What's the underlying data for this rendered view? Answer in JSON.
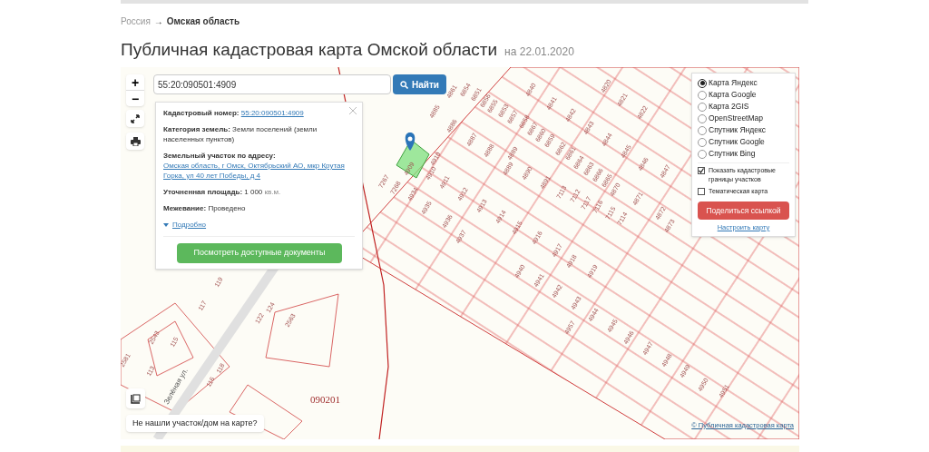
{
  "breadcrumb": {
    "items": [
      {
        "text": "Россия",
        "current": false
      },
      {
        "text": "Омская область",
        "current": true
      }
    ],
    "separator": "→"
  },
  "title": {
    "text": "Публичная кадастровая карта Омской области",
    "date": "на 22.01.2020"
  },
  "search": {
    "value": "55:20:090501:4909",
    "button": "Найти"
  },
  "map_controls": {
    "zoom_in": "+",
    "zoom_out": "−"
  },
  "info_popup": {
    "fields": [
      {
        "label": "Кадастровый номер:",
        "value": "55:20:090501:4909",
        "kind": "link"
      },
      {
        "label": "Категория земель:",
        "value": "Земли поселений (земли населенных пунктов)",
        "kind": "text"
      },
      {
        "label": "Земельный участок по адресу:",
        "value": "Омская область, г Омск, Октябрьский АО, мкр Крутая Горка, ул 40 лет Победы, д 4",
        "kind": "link"
      },
      {
        "label": "Уточненная площадь:",
        "value": "1 000",
        "unit": "кв.м.",
        "kind": "text"
      },
      {
        "label": "Межевание:",
        "value": "Проведено",
        "kind": "text"
      }
    ],
    "more_link": "Подробно",
    "button": "Посмотреть доступные документы"
  },
  "layers": {
    "base_maps": [
      {
        "label": "Карта Яндекс",
        "selected": true
      },
      {
        "label": "Карта Google",
        "selected": false
      },
      {
        "label": "Карта 2GIS",
        "selected": false
      },
      {
        "label": "OpenStreetMap",
        "selected": false
      },
      {
        "label": "Спутник Яндекс",
        "selected": false
      },
      {
        "label": "Спутник Google",
        "selected": false
      },
      {
        "label": "Спутник Bing",
        "selected": false
      }
    ],
    "overlays": [
      {
        "label": "Показать кадастровые границы участков",
        "checked": true
      },
      {
        "label": "Тематическая карта",
        "checked": false
      }
    ],
    "share_button": "Поделиться ссылкой",
    "settings_link": "Настроить карту"
  },
  "map": {
    "labels": [
      "4861",
      "6854",
      "6851",
      "6856",
      "6855",
      "6853",
      "6857",
      "6858",
      "6867",
      "6860",
      "6859",
      "6862",
      "6861",
      "6864",
      "6863",
      "6866",
      "6865",
      "4885",
      "4886",
      "4887",
      "4888",
      "4889",
      "4889",
      "4890",
      "4891",
      "7113",
      "7112",
      "7117",
      "7116",
      "7115",
      "7114",
      "4870",
      "4871",
      "4872",
      "4873",
      "4840",
      "4841",
      "4842",
      "4843",
      "4844",
      "4845",
      "4846",
      "4847",
      "4820",
      "4821",
      "4822",
      "4910",
      "4910",
      "4909",
      "4911",
      "4912",
      "4913",
      "4914",
      "4915",
      "4916",
      "4934",
      "4935",
      "4936",
      "4937",
      "7267",
      "7268",
      "4917",
      "4918",
      "4940",
      "4941",
      "4942",
      "4943",
      "4944",
      "4945",
      "4946",
      "4947",
      "4948",
      "4949",
      "4950",
      "4951",
      "4957",
      "4919",
      "119",
      "117",
      "124",
      "122",
      "2563",
      "2543",
      "115",
      "2581",
      "113",
      "118",
      "116"
    ],
    "district": "090201",
    "street": "Зелёная ул."
  },
  "not_found_button": "Не нашли участок/дом на карте?",
  "attribution": "© Публичная кадастровая карта"
}
